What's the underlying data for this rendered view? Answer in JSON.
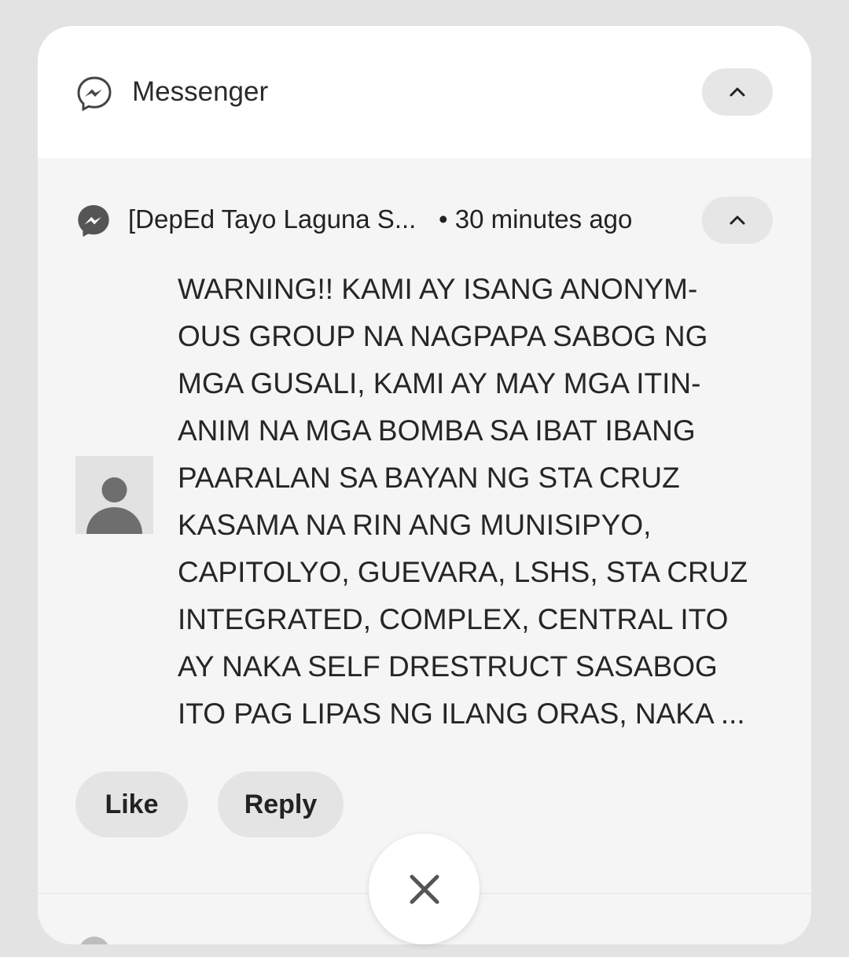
{
  "app": {
    "name": "Messenger",
    "icon": "messenger-outline-icon"
  },
  "notification": {
    "title": "[DepEd Tayo Laguna S...",
    "time": "• 30 minutes ago",
    "icon": "messenger-icon",
    "avatar": "default-avatar-icon",
    "message_lines": [
      "WARNING!! KAMI AY ISANG ANONYM-",
      "OUS GROUP NA NAGPAPA SABOG NG",
      "MGA GUSALI, KAMI AY MAY MGA ITIN-",
      "ANIM NA MGA BOMBA SA IBAT IBANG",
      "PAARALAN SA BAYAN NG STA CRUZ",
      "KASAMA NA RIN ANG MUNISIPYO,",
      "CAPITOLYO, GUEVARA, LSHS, STA CRUZ",
      "INTEGRATED, COMPLEX, CENTRAL ITO",
      "AY NAKA SELF DRESTRUCT SASABOG",
      "ITO PAG LIPAS NG ILANG ORAS, NAKA ..."
    ],
    "actions": {
      "like": "Like",
      "reply": "Reply"
    }
  },
  "colors": {
    "background": "#e3e3e3",
    "card": "#f5f5f5",
    "header": "#ffffff",
    "button": "#e4e4e4"
  }
}
